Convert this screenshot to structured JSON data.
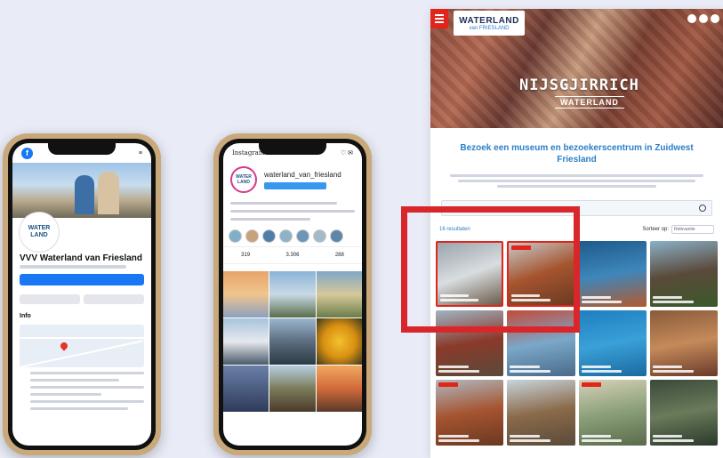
{
  "facebook": {
    "page_name": "VVV Waterland van Friesland",
    "info_label": "Info",
    "avatar_text": "WATER LAND"
  },
  "instagram": {
    "brand": "Instagram",
    "username": "waterland_van_friesland",
    "avatar_text": "WATER LAND",
    "stats": [
      "319",
      "3.306",
      "288"
    ]
  },
  "website": {
    "logo_main": "WATERLAND",
    "logo_sub": "van FRIESLAND",
    "hero_title": "NIJSGJIRRICH",
    "hero_subtitle": "WATERLAND",
    "heading": "Bezoek een museum en bezoekerscentrum in Zuidwest Friesland",
    "results_label": "16 resultaten",
    "sort_label": "Sorteer op:",
    "sort_value": "Relevantie"
  },
  "colors": {
    "accent_red": "#d9262a",
    "brand_blue": "#2a7fc7",
    "facebook_blue": "#1877f2"
  }
}
